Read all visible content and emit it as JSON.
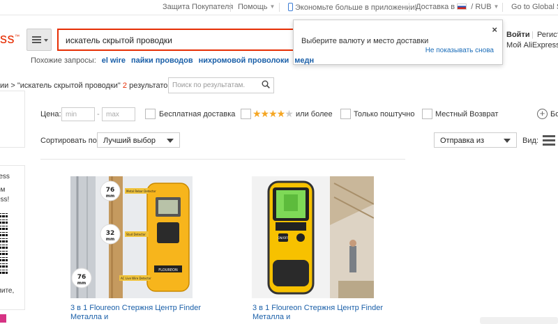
{
  "topbar": {
    "buyer_protection": "Защита Покупателя",
    "help": "Помощь",
    "app_promo": "Экономьте больше в приложении!",
    "ship_to": "Доставка в",
    "currency": "RUB",
    "global_site": "Go to Global Si"
  },
  "header": {
    "logo_text": "ss",
    "logo_mark": "™",
    "search_value": "искатель скрытой проводки"
  },
  "popover": {
    "message": "Выберите валюту и место доставки",
    "dismiss": "Не показывать снова",
    "close": "×"
  },
  "account": {
    "login": "Войти",
    "register": "Регист",
    "my": "Мой AliExpress"
  },
  "related": {
    "label": "Похожие запросы:",
    "items": [
      "el wire",
      "пайки проводов",
      "нихромовой проволоки",
      "медн"
    ]
  },
  "breadcrumb": {
    "prefix": "ии > \"искатель скрытой проводки\"",
    "count": "2",
    "suffix": "результатов >",
    "within_placeholder": "Поиск по результатам."
  },
  "filters": {
    "price_label": "Цена:",
    "min_placeholder": "min",
    "dash": "-",
    "max_placeholder": "max",
    "free_shipping": "Бесплатная доставка",
    "rating_suffix": "или более",
    "stars_filled": 4,
    "stars_total": 5,
    "single_piece": "Только поштучно",
    "local_return": "Местный Возврат",
    "more": "Бо"
  },
  "sort": {
    "label": "Сортировать по:",
    "value": "Лучший выбор",
    "ship_from": "Отправка из",
    "view_label": "Вид:"
  },
  "sidebar": {
    "lines": [
      "ress",
      "ом",
      "ess!",
      "мите,"
    ]
  },
  "products": [
    {
      "title": "3 в 1 Floureon Стержня Центр Finder Металла и",
      "labels": [
        "Metal Rebar Detector",
        "Stud Detector",
        "AC Live Wire Detector"
      ],
      "depths": [
        "76",
        "32",
        "76"
      ],
      "unit": "mm",
      "brand": "FLOUREON"
    },
    {
      "title": "3 в 1 Floureon Стержня Центр Finder Металла и",
      "button": "ON/OFF"
    }
  ],
  "colors": {
    "brand": "#e62e04",
    "link": "#1a5fa8",
    "star": "#f5a623",
    "device": "#f7b51c"
  }
}
